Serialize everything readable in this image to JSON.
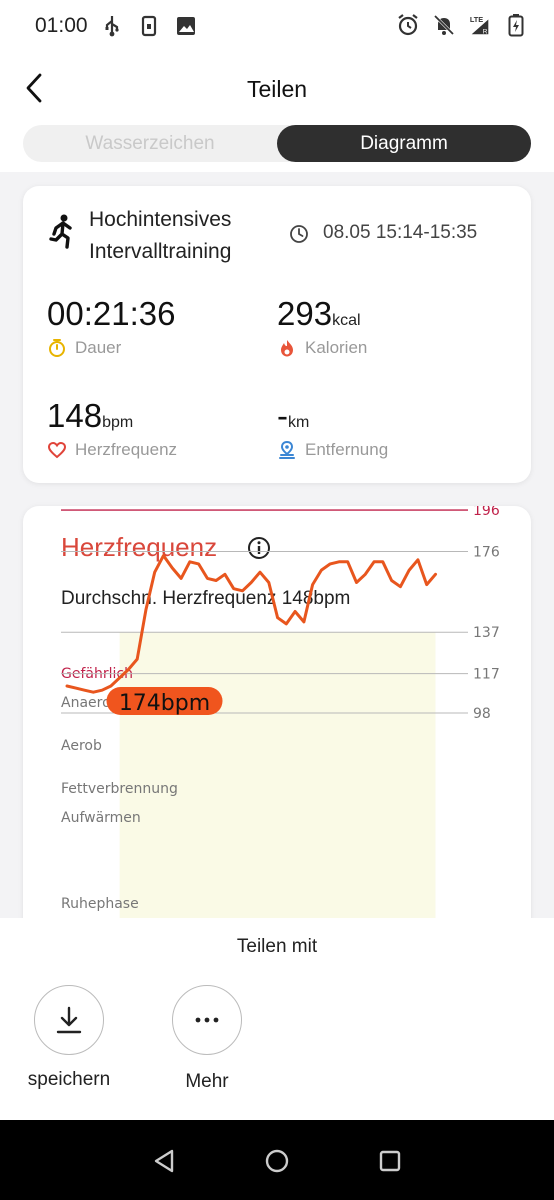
{
  "status": {
    "time": "01:00",
    "icons_left": [
      "usb-icon",
      "sim-icon",
      "image-icon"
    ],
    "icons_right": [
      "alarm-icon",
      "bell-off-icon",
      "lte-signal-icon",
      "battery-icon"
    ],
    "network_label": "LTE"
  },
  "header": {
    "title": "Teilen",
    "tabs": [
      {
        "label": "Wasserzeichen",
        "active": false
      },
      {
        "label": "Diagramm",
        "active": true
      }
    ]
  },
  "workout": {
    "activity_line1": "Hochintensives",
    "activity_line2": "Intervalltraining",
    "time_range": "08.05 15:14-15:35",
    "metrics": {
      "duration": {
        "value": "00:21:36",
        "unit": "",
        "label": "Dauer",
        "icon": "stopwatch-icon",
        "color": "#e8b400"
      },
      "calories": {
        "value": "293",
        "unit": "kcal",
        "label": "Kalorien",
        "icon": "flame-icon",
        "color": "#e8553a"
      },
      "heart_rate": {
        "value": "148",
        "unit": "bpm",
        "label": "Herzfrequenz",
        "icon": "heart-icon",
        "color": "#e0443a"
      },
      "distance": {
        "value": "-",
        "unit": "km",
        "label": "Entfernung",
        "icon": "location-icon",
        "color": "#3b86d4"
      }
    }
  },
  "heart_section": {
    "title": "Herzfrequenz",
    "avg_text": "Durchschn. Herzfrequenz 148bpm",
    "peak_badge": "174bpm"
  },
  "chart_data": {
    "type": "line",
    "zones": [
      {
        "name": "Gefährlich",
        "threshold": 196,
        "color": "#c0224a"
      },
      {
        "name": "Anaerob",
        "threshold": 176
      },
      {
        "name": "Aerob",
        "threshold": 137
      },
      {
        "name": "Fettverbrennung",
        "threshold": 117
      },
      {
        "name": "Aufwärmen",
        "threshold": 98
      },
      {
        "name": "Ruhephase",
        "threshold": null
      }
    ],
    "tick_labels": [
      "196",
      "176",
      "137",
      "117",
      "98"
    ],
    "ylim": [
      75,
      205
    ],
    "xlim": [
      0,
      21.6
    ],
    "x": [
      0,
      0.5,
      1.0,
      1.5,
      2.0,
      2.5,
      3.0,
      3.5,
      4.0,
      4.5,
      5.0,
      5.5,
      6.0,
      6.5,
      7.0,
      7.5,
      8.0,
      8.5,
      9.0,
      9.5,
      10.0,
      10.5,
      11.0,
      11.5,
      12.0,
      12.5,
      13.0,
      13.5,
      14.0,
      14.5,
      15.0,
      15.5,
      16.0,
      16.5,
      17.0,
      17.5,
      18.0,
      18.5,
      19.0,
      19.5,
      20.0,
      20.5,
      21.0
    ],
    "values": [
      111,
      110,
      109,
      108,
      109,
      111,
      115,
      119,
      124,
      148,
      166,
      174,
      168,
      163,
      171,
      170,
      163,
      162,
      165,
      158,
      157,
      161,
      166,
      161,
      144,
      141,
      147,
      142,
      160,
      167,
      170,
      171,
      171,
      161,
      165,
      171,
      171,
      162,
      159,
      167,
      172,
      160,
      165
    ],
    "peak": {
      "value": 174,
      "label": "174bpm"
    },
    "line_colors": {
      "low": "#3fbf5f",
      "mid": "#e89a1a",
      "high": "#e8561e"
    },
    "fill_color": "#fafae6"
  },
  "share": {
    "title": "Teilen mit",
    "options": [
      {
        "label": "speichern",
        "icon": "download-icon"
      },
      {
        "label": "Mehr",
        "icon": "more-icon"
      }
    ]
  }
}
